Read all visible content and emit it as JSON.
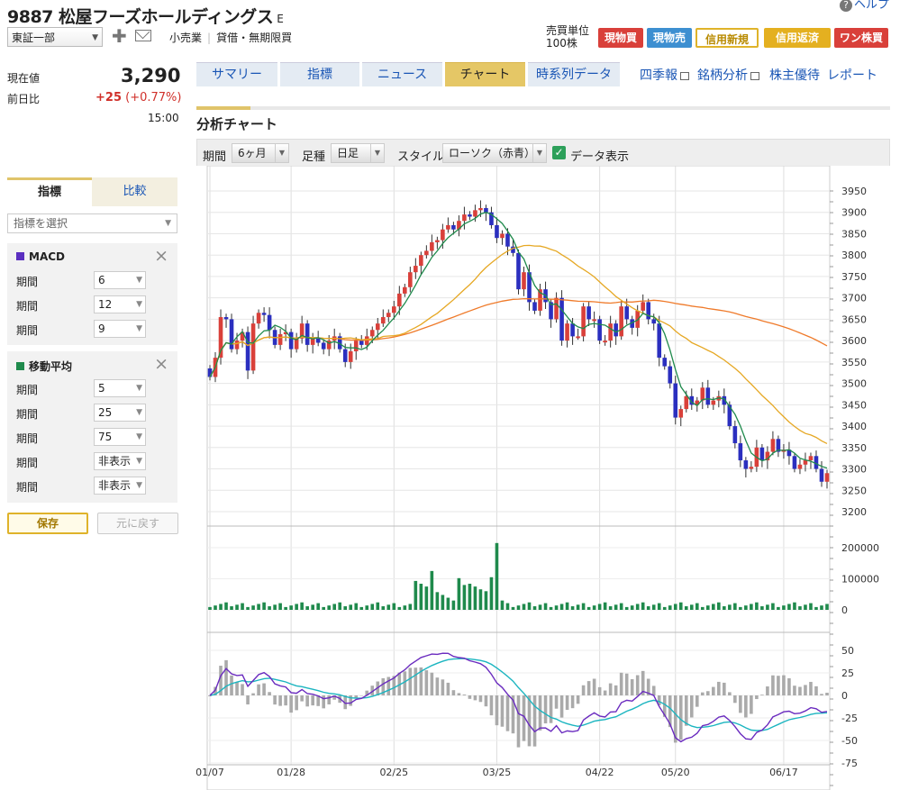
{
  "header": {
    "code_name": "9887 松屋フーズホールディングス",
    "market_suffix": "E",
    "help": "ヘルプ",
    "market": "東証一部",
    "sector": "小売業",
    "credit": "貸借・無期限買",
    "unit_label": "売買単位",
    "unit_value": "100株",
    "trade_buttons": [
      "現物買",
      "現物売",
      "信用新規",
      "信用返済",
      "ワン株買"
    ]
  },
  "quote": {
    "price_label": "現在値",
    "price": "3,290",
    "change_label": "前日比",
    "change": "+25",
    "change_pct": "(+0.77%)",
    "time": "15:00"
  },
  "colors": {
    "up": "#d9403a",
    "down": "#2b2fbf",
    "ma5": "#1f8a4c",
    "ma25": "#e6a824",
    "ma75": "#ef7a2a",
    "macd": "#6a2bbf",
    "signal": "#1bb5c0"
  },
  "sidebar": {
    "tabs": [
      "指標",
      "比較"
    ],
    "select_placeholder": "指標を選択",
    "macd": {
      "title": "MACD",
      "rows": [
        {
          "label": "期間",
          "value": "6"
        },
        {
          "label": "期間",
          "value": "12"
        },
        {
          "label": "期間",
          "value": "9"
        }
      ]
    },
    "ma": {
      "title": "移動平均",
      "rows": [
        {
          "label": "期間",
          "value": "5"
        },
        {
          "label": "期間",
          "value": "25"
        },
        {
          "label": "期間",
          "value": "75"
        },
        {
          "label": "期間",
          "value": "非表示"
        },
        {
          "label": "期間",
          "value": "非表示"
        }
      ]
    },
    "save": "保存",
    "reset": "元に戻す"
  },
  "tabs": [
    "サマリー",
    "指標",
    "ニュース",
    "チャート",
    "時系列データ"
  ],
  "active_tab": "チャート",
  "links": [
    "四季報",
    "銘柄分析",
    "株主優待",
    "レポート"
  ],
  "chart_title": "分析チャート",
  "controls": {
    "period_label": "期間",
    "period_value": "6ヶ月",
    "foot_label": "足種",
    "foot_value": "日足",
    "style_label": "スタイル",
    "style_value": "ローソク（赤青）",
    "data_label": "データ表示"
  },
  "chart_data": {
    "type": "candlestick",
    "price_axis": {
      "min": 3200,
      "max": 3950,
      "ticks": [
        3950,
        3900,
        3850,
        3800,
        3750,
        3700,
        3650,
        3600,
        3550,
        3500,
        3450,
        3400,
        3350,
        3300,
        3250,
        3200
      ]
    },
    "volume_axis": {
      "ticks": [
        200000,
        100000,
        0
      ]
    },
    "macd_axis": {
      "ticks": [
        50,
        25,
        0,
        -25,
        -50,
        -75
      ]
    },
    "x_labels": [
      "01/07",
      "01/28",
      "02/25",
      "03/25",
      "04/22",
      "05/20",
      "06/17"
    ],
    "x_label_index": [
      0,
      15,
      34,
      53,
      72,
      86,
      106
    ],
    "series": {
      "close": [
        3515,
        3560,
        3655,
        3650,
        3580,
        3600,
        3620,
        3530,
        3640,
        3665,
        3660,
        3625,
        3590,
        3615,
        3620,
        3580,
        3605,
        3640,
        3590,
        3605,
        3595,
        3580,
        3600,
        3610,
        3580,
        3550,
        3575,
        3600,
        3590,
        3610,
        3625,
        3640,
        3655,
        3665,
        3680,
        3710,
        3725,
        3760,
        3775,
        3800,
        3810,
        3830,
        3835,
        3860,
        3870,
        3860,
        3880,
        3895,
        3890,
        3905,
        3910,
        3900,
        3870,
        3840,
        3850,
        3820,
        3805,
        3720,
        3760,
        3690,
        3670,
        3720,
        3690,
        3650,
        3700,
        3600,
        3640,
        3610,
        3610,
        3680,
        3650,
        3650,
        3600,
        3600,
        3640,
        3610,
        3680,
        3650,
        3630,
        3670,
        3690,
        3650,
        3640,
        3560,
        3540,
        3500,
        3420,
        3440,
        3470,
        3450,
        3460,
        3490,
        3450,
        3460,
        3470,
        3450,
        3400,
        3360,
        3320,
        3300,
        3305,
        3350,
        3320,
        3340,
        3370,
        3340,
        3345,
        3330,
        3300,
        3310,
        3320,
        3330,
        3300,
        3270,
        3290
      ]
    },
    "volume_peaks": {
      "02/25": 125000,
      "03/25": 215000
    }
  }
}
